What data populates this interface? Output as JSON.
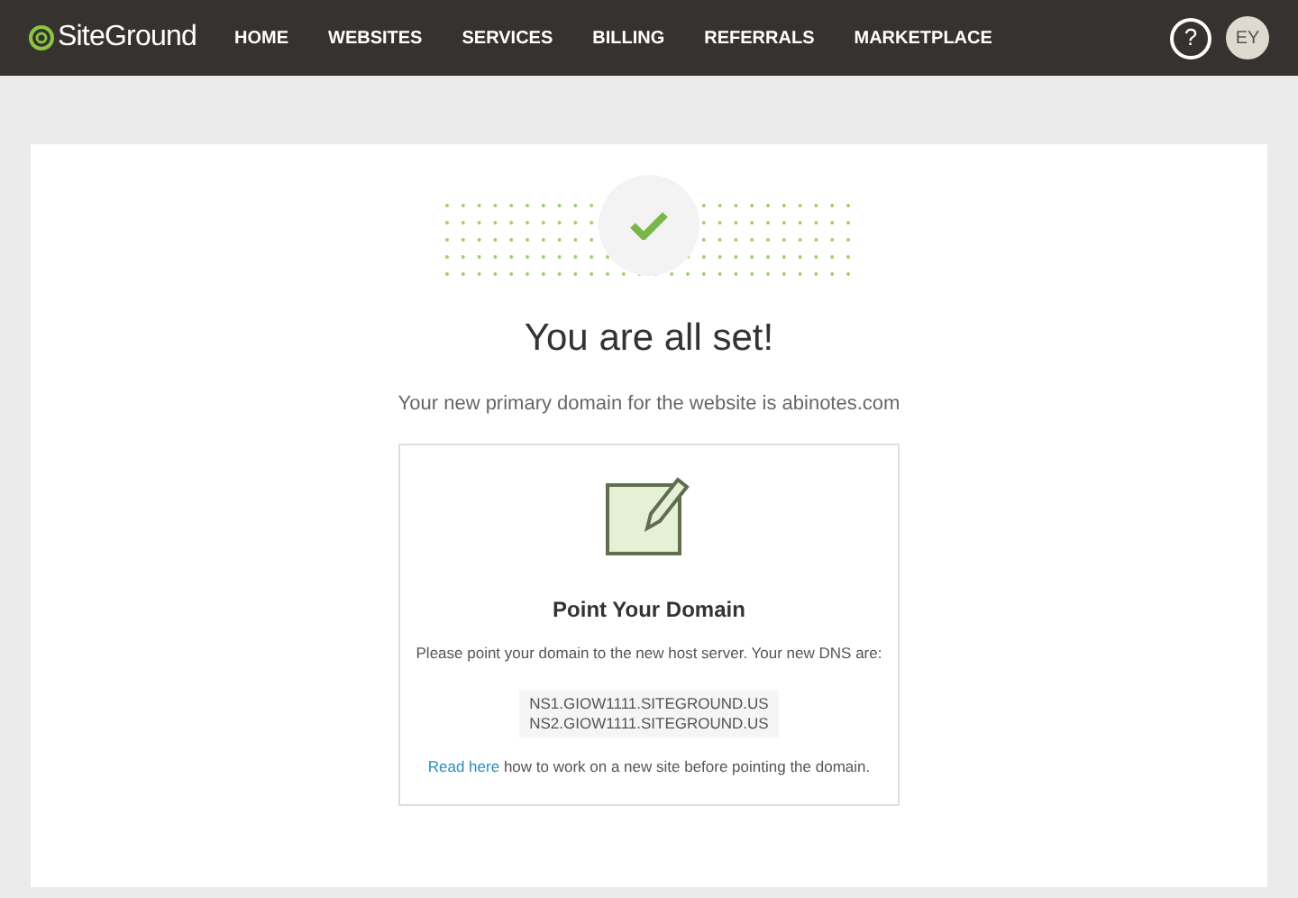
{
  "header": {
    "logo": "SiteGround",
    "nav": [
      "HOME",
      "WEBSITES",
      "SERVICES",
      "BILLING",
      "REFERRALS",
      "MARKETPLACE"
    ],
    "help": "?",
    "avatar": "EY"
  },
  "main": {
    "title": "You are all set!",
    "subtitle": "Your new primary domain for the website is abinotes.com",
    "card": {
      "title": "Point Your Domain",
      "text": "Please point your domain to the new host server. Your new DNS are:",
      "dns": [
        "NS1.GIOW1111.SITEGROUND.US",
        "NS2.GIOW1111.SITEGROUND.US"
      ],
      "link": "Read here",
      "note": "how to work on a new site before pointing the domain."
    }
  }
}
